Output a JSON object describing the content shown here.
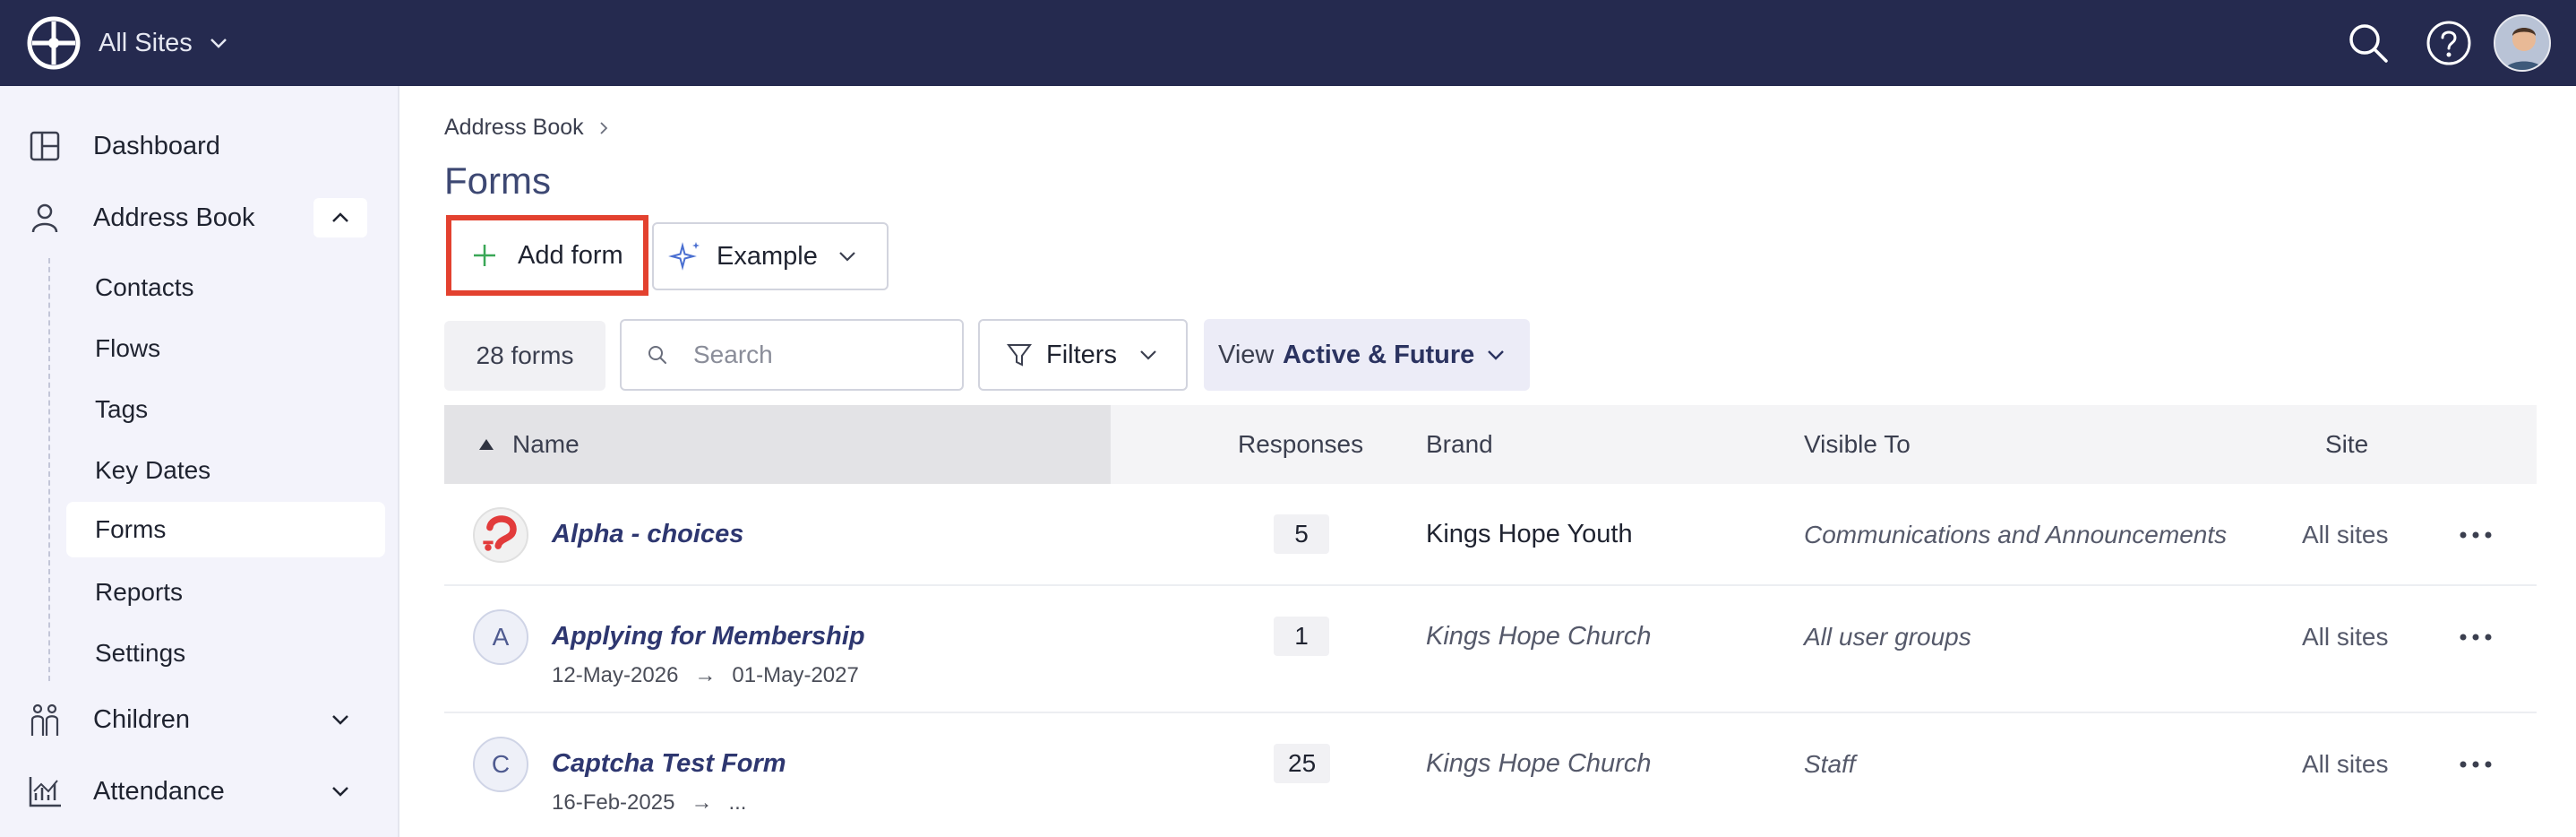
{
  "topbar": {
    "site_selector": "All Sites",
    "icons": [
      "globe-logo-icon",
      "search-icon",
      "help-icon",
      "avatar"
    ]
  },
  "sidebar": {
    "items": [
      {
        "label": "Dashboard",
        "icon": "dashboard-icon"
      },
      {
        "label": "Address Book",
        "icon": "person-icon",
        "expanded": true
      },
      {
        "label": "Children",
        "icon": "children-icon"
      },
      {
        "label": "Attendance",
        "icon": "chart-icon"
      }
    ],
    "address_book_sub": [
      {
        "label": "Contacts"
      },
      {
        "label": "Flows"
      },
      {
        "label": "Tags"
      },
      {
        "label": "Key Dates"
      },
      {
        "label": "Forms",
        "active": true
      },
      {
        "label": "Reports"
      },
      {
        "label": "Settings"
      }
    ]
  },
  "breadcrumb": {
    "item": "Address Book"
  },
  "page": {
    "title": "Forms"
  },
  "toolbar": {
    "add_form_label": "Add form",
    "example_label": "Example",
    "count_label": "28 forms",
    "search_placeholder": "Search",
    "filters_label": "Filters",
    "view_prefix": "View",
    "view_value": "Active & Future"
  },
  "table": {
    "columns": [
      "Name",
      "Responses",
      "Brand",
      "Visible To",
      "Site"
    ],
    "rows": [
      {
        "icon_letter": "",
        "name": "Alpha - choices",
        "dates": null,
        "responses": "5",
        "brand": "Kings Hope Youth",
        "visible_to": "Communications and Announcements",
        "site": "All sites"
      },
      {
        "icon_letter": "A",
        "name": "Applying for Membership",
        "start": "12-May-2026",
        "arrow": "→",
        "end": "01-May-2027",
        "responses": "1",
        "brand": "Kings Hope Church",
        "visible_to": "All user groups",
        "site": "All sites"
      },
      {
        "icon_letter": "C",
        "name": "Captcha Test Form",
        "start": "16-Feb-2025",
        "arrow": "→",
        "end": "...",
        "responses": "25",
        "brand": "Kings Hope Church",
        "visible_to": "Staff",
        "site": "All sites"
      }
    ]
  },
  "colors": {
    "topbar": "#252a4f",
    "sidebar": "#f3f3fb",
    "highlight": "#e3412f",
    "link": "#2e3770"
  }
}
